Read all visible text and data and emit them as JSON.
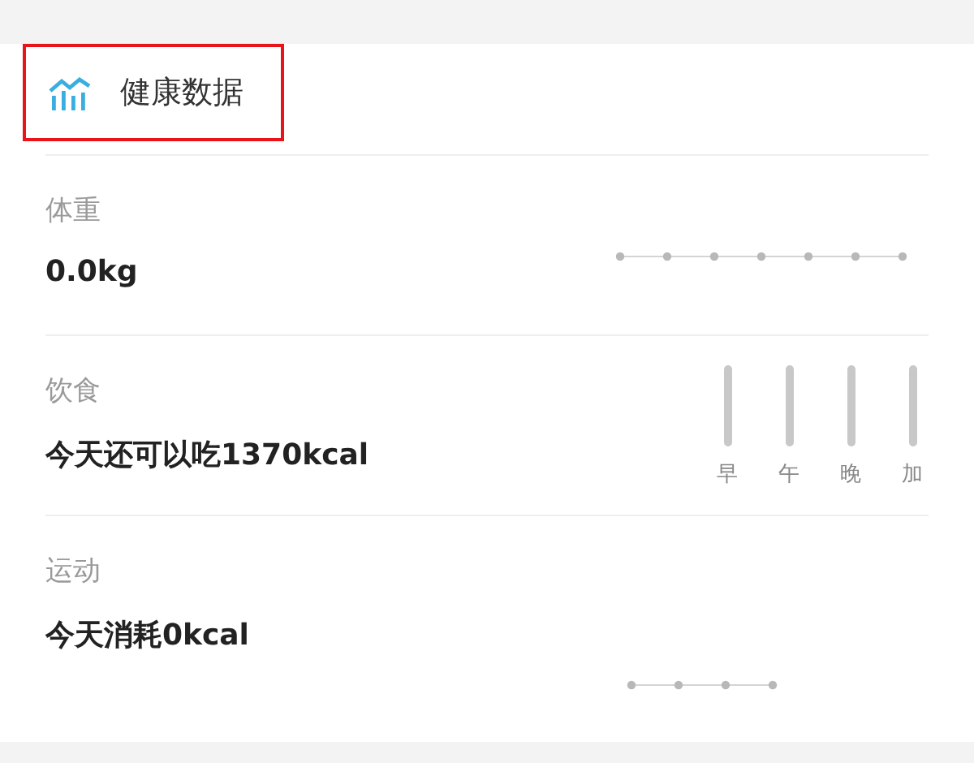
{
  "header": {
    "title": "健康数据",
    "highlighted": true
  },
  "rows": [
    {
      "kind": "trend",
      "label": "体重",
      "value": "0.0kg"
    },
    {
      "kind": "meal-bars",
      "label": "饮食",
      "value": "今天还可以吃1370kcal",
      "meals": [
        "早",
        "午",
        "晚",
        "加"
      ]
    },
    {
      "kind": "steps",
      "label": "运动",
      "value": "今天消耗0kcal"
    }
  ]
}
